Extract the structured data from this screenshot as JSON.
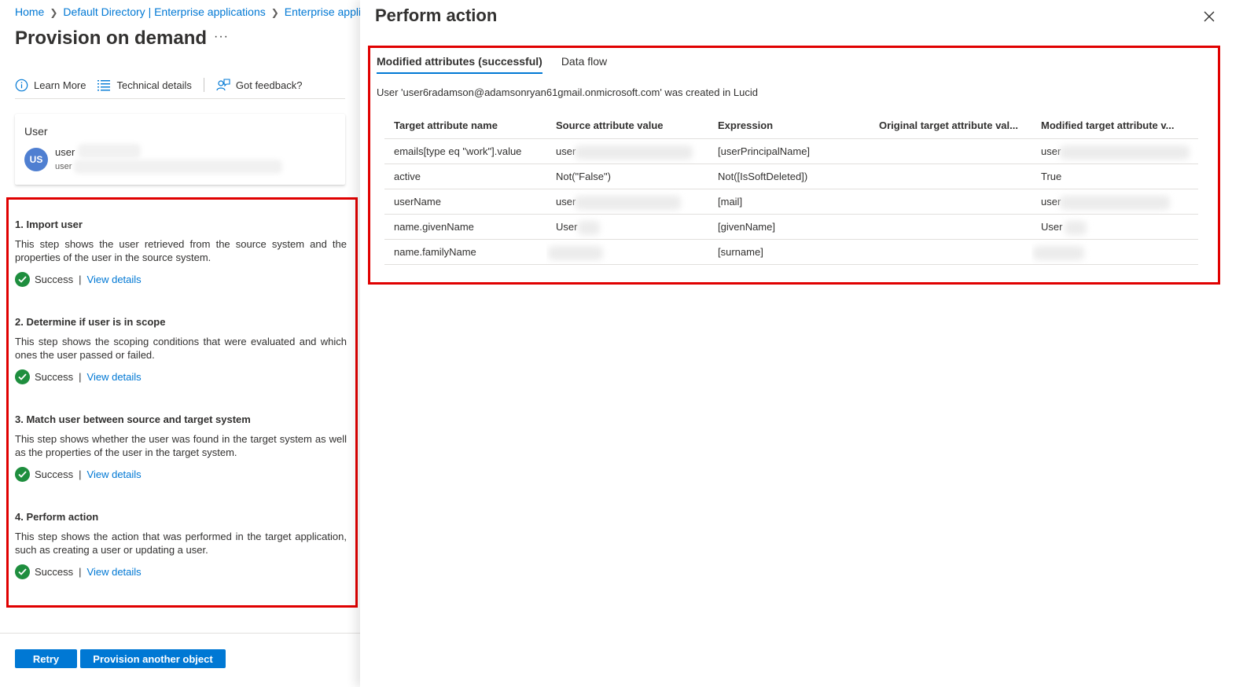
{
  "breadcrumb": {
    "items": [
      "Home",
      "Default Directory | Enterprise applications",
      "Enterprise applic"
    ]
  },
  "page": {
    "title": "Provision on demand",
    "more": "···"
  },
  "toolbar": {
    "learn_more": "Learn More",
    "technical_details": "Technical details",
    "feedback": "Got feedback?"
  },
  "user_card": {
    "label": "User",
    "avatar_initials": "US",
    "name": "user",
    "sub": "user"
  },
  "steps": [
    {
      "title": "1. Import user",
      "description": "This step shows the user retrieved from the source system and the properties of the user in the source system.",
      "status": "Success",
      "link": "View details"
    },
    {
      "title": "2. Determine if user is in scope",
      "description": "This step shows the scoping conditions that were evaluated and which ones the user passed or failed.",
      "status": "Success",
      "link": "View details"
    },
    {
      "title": "3. Match user between source and target system",
      "description": "This step shows whether the user was found in the target system as well as the properties of the user in the target system.",
      "status": "Success",
      "link": "View details"
    },
    {
      "title": "4. Perform action",
      "description": "This step shows the action that was performed in the target application, such as creating a user or updating a user.",
      "status": "Success",
      "link": "View details"
    }
  ],
  "buttons": {
    "retry": "Retry",
    "provision_another": "Provision another object"
  },
  "panel": {
    "title": "Perform action",
    "tabs": [
      "Modified attributes (successful)",
      "Data flow"
    ],
    "active_tab": 0,
    "message": "User 'user6radamson@adamsonryan61gmail.onmicrosoft.com' was created in Lucid",
    "table": {
      "headers": [
        "Target attribute name",
        "Source attribute value",
        "Expression",
        "Original target attribute val...",
        "Modified target attribute v..."
      ],
      "rows": [
        [
          "emails[type eq \"work\"].value",
          "user",
          "[userPrincipalName]",
          "",
          "user"
        ],
        [
          "active",
          "Not(\"False\")",
          "Not([IsSoftDeleted])",
          "",
          "True"
        ],
        [
          "userName",
          "user",
          "[mail]",
          "",
          "user"
        ],
        [
          "name.givenName",
          "User",
          "[givenName]",
          "",
          "User"
        ],
        [
          "name.familyName",
          "",
          "[surname]",
          "",
          ""
        ]
      ]
    }
  },
  "colors": {
    "accent": "#0078d4",
    "success": "#1e8e3e",
    "highlight": "#e00000"
  }
}
